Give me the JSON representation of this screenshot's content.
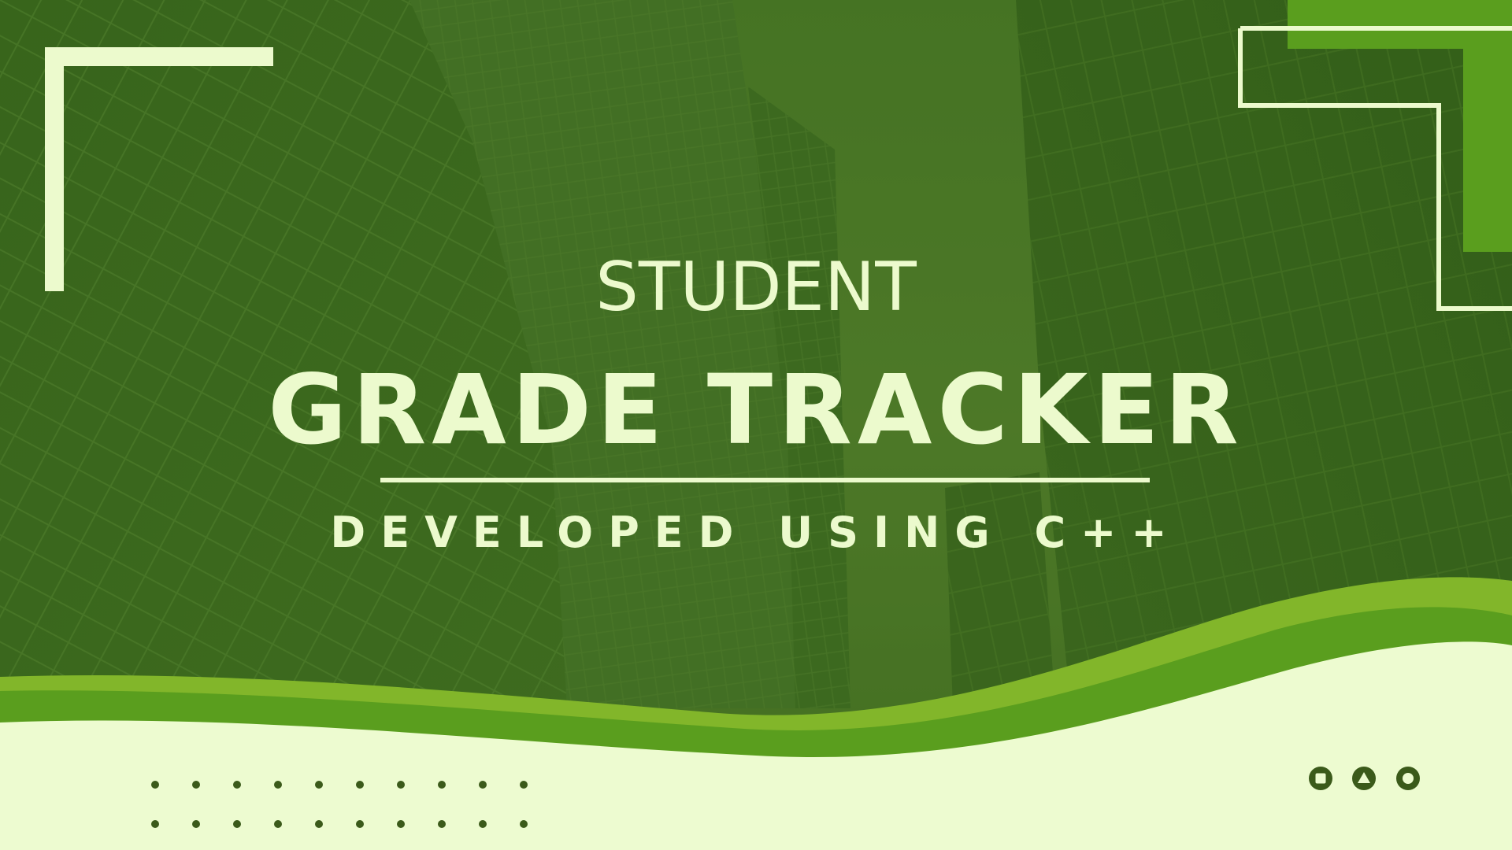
{
  "title": {
    "line1": "STUDENT",
    "line2": "GRADE TRACKER"
  },
  "subtitle": "DEVELOPED USING C++",
  "colors": {
    "overlay_green": "#3f6e22",
    "text_cream": "#ecfacd",
    "accent_green": "#5a9e1e",
    "wave_light": "#82b62a",
    "footer_cream": "#edfbd0",
    "dot_dark": "#3b5a1a"
  },
  "icons": {
    "circle_square": "square-in-circle-icon",
    "circle_triangle": "triangle-in-circle-icon",
    "circle_circle": "circle-in-circle-icon"
  }
}
